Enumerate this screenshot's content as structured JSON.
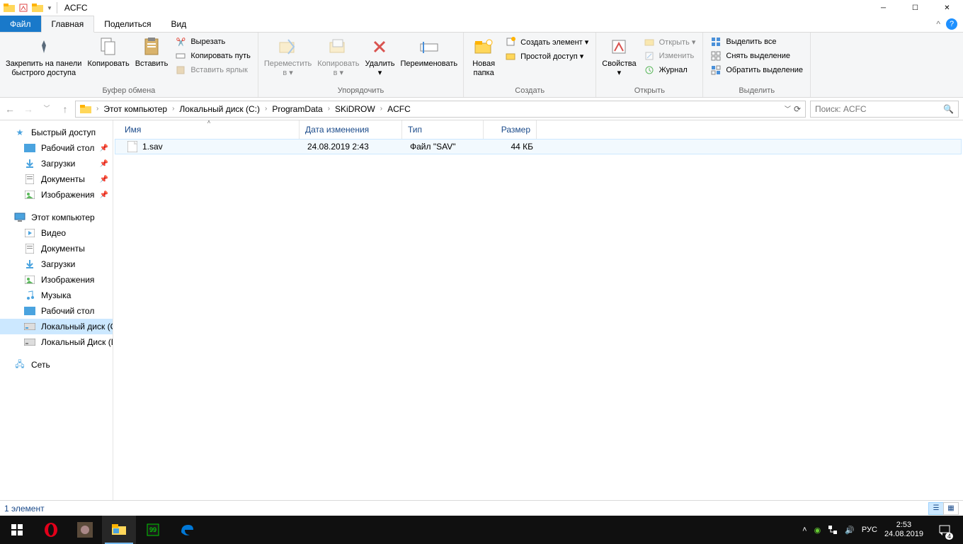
{
  "window": {
    "title": "ACFC"
  },
  "tabs": {
    "file": "Файл",
    "home": "Главная",
    "share": "Поделиться",
    "view": "Вид"
  },
  "ribbon": {
    "clipboard": {
      "pin": "Закрепить на панели\nбыстрого доступа",
      "copy": "Копировать",
      "paste": "Вставить",
      "cut": "Вырезать",
      "copy_path": "Копировать путь",
      "paste_shortcut": "Вставить ярлык",
      "label": "Буфер обмена"
    },
    "organize": {
      "move_to": "Переместить\nв ▾",
      "copy_to": "Копировать\nв ▾",
      "delete": "Удалить\n▾",
      "rename": "Переименовать",
      "label": "Упорядочить"
    },
    "new": {
      "new_folder": "Новая\nпапка",
      "new_item": "Создать элемент ▾",
      "easy_access": "Простой доступ ▾",
      "label": "Создать"
    },
    "open": {
      "properties": "Свойства\n▾",
      "open": "Открыть ▾",
      "edit": "Изменить",
      "history": "Журнал",
      "label": "Открыть"
    },
    "select": {
      "select_all": "Выделить все",
      "select_none": "Снять выделение",
      "invert": "Обратить выделение",
      "label": "Выделить"
    }
  },
  "breadcrumb": {
    "items": [
      "Этот компьютер",
      "Локальный диск (C:)",
      "ProgramData",
      "SKiDROW",
      "ACFC"
    ]
  },
  "search": {
    "placeholder": "Поиск: ACFC"
  },
  "sidebar": {
    "quick_access": "Быстрый доступ",
    "quick_items": [
      {
        "label": "Рабочий стол",
        "pinned": true
      },
      {
        "label": "Загрузки",
        "pinned": true
      },
      {
        "label": "Документы",
        "pinned": true
      },
      {
        "label": "Изображения",
        "pinned": true
      }
    ],
    "this_pc": "Этот компьютер",
    "pc_items": [
      {
        "label": "Видео"
      },
      {
        "label": "Документы"
      },
      {
        "label": "Загрузки"
      },
      {
        "label": "Изображения"
      },
      {
        "label": "Музыка"
      },
      {
        "label": "Рабочий стол"
      },
      {
        "label": "Локальный диск (C:)",
        "selected": true
      },
      {
        "label": "Локальный Диск (D:)"
      }
    ],
    "network": "Сеть"
  },
  "columns": {
    "name": "Имя",
    "date": "Дата изменения",
    "type": "Тип",
    "size": "Размер"
  },
  "files": [
    {
      "name": "1.sav",
      "date": "24.08.2019 2:43",
      "type": "Файл \"SAV\"",
      "size": "44 КБ"
    }
  ],
  "status": {
    "count": "1 элемент"
  },
  "taskbar": {
    "lang": "РУС",
    "time": "2:53",
    "date": "24.08.2019",
    "notif_count": "4"
  }
}
